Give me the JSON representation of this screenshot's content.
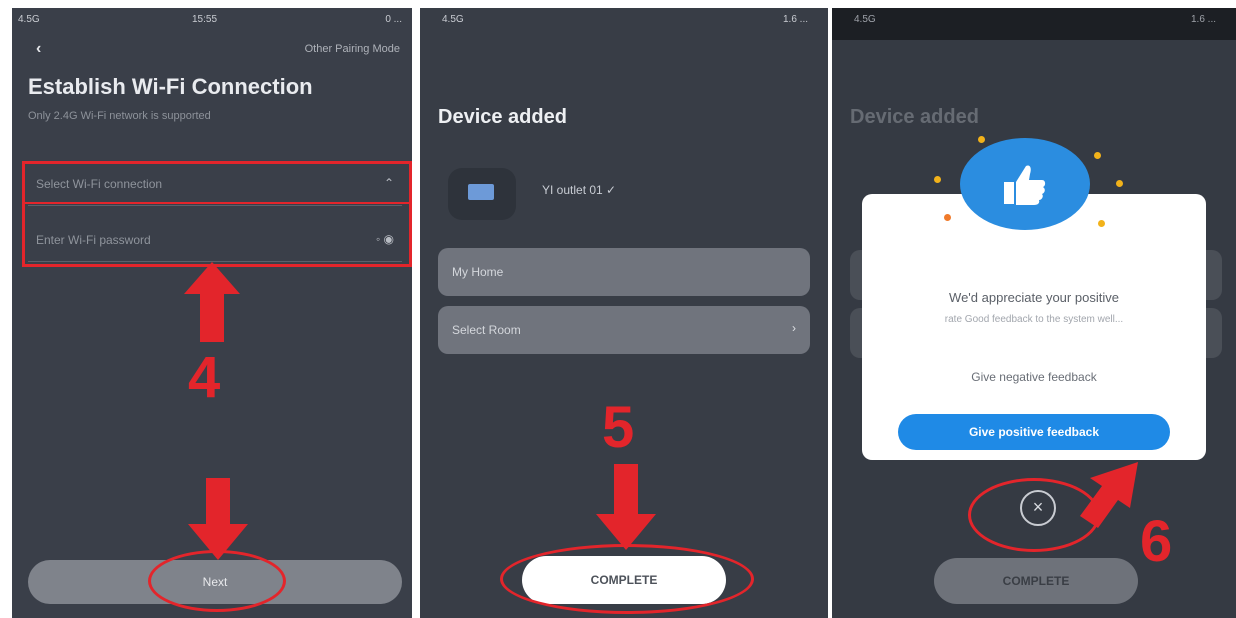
{
  "panel1": {
    "statusbar": {
      "left": "4.5G",
      "center": "15:55",
      "right": "0 ..."
    },
    "back_icon": "‹",
    "other_pairing": "Other Pairing Mode",
    "title": "Establish Wi-Fi Connection",
    "subtitle": "Only 2.4G Wi-Fi network is supported",
    "wifi_select_placeholder": "Select Wi-Fi connection",
    "wifi_password_placeholder": "Enter Wi-Fi password",
    "step_label": "4",
    "next_button": "Next"
  },
  "panel2": {
    "statusbar": {
      "left": "4.5G",
      "right": "1.6 ..."
    },
    "title": "Device added",
    "device_name": "YI outlet 01 ✓",
    "home_value": "My Home",
    "room_placeholder": "Select Room",
    "room_chevron": "›",
    "step_label": "5",
    "complete_button": "COMPLETE"
  },
  "panel3": {
    "statusbar": {
      "left": "4.5G",
      "right": "1.6 ..."
    },
    "title": "Device added",
    "dialog_title": "We'd appreciate your positive",
    "dialog_subtitle": "rate Good feedback to the system well...",
    "negative_feedback": "Give negative feedback",
    "positive_feedback": "Give positive feedback",
    "close_icon": "×",
    "step_label": "6",
    "complete_button": "COMPLETE"
  },
  "colors": {
    "annotation_red": "#e3252b",
    "accent_blue": "#1f8ae6",
    "panel_bg": "#3a3f49"
  }
}
